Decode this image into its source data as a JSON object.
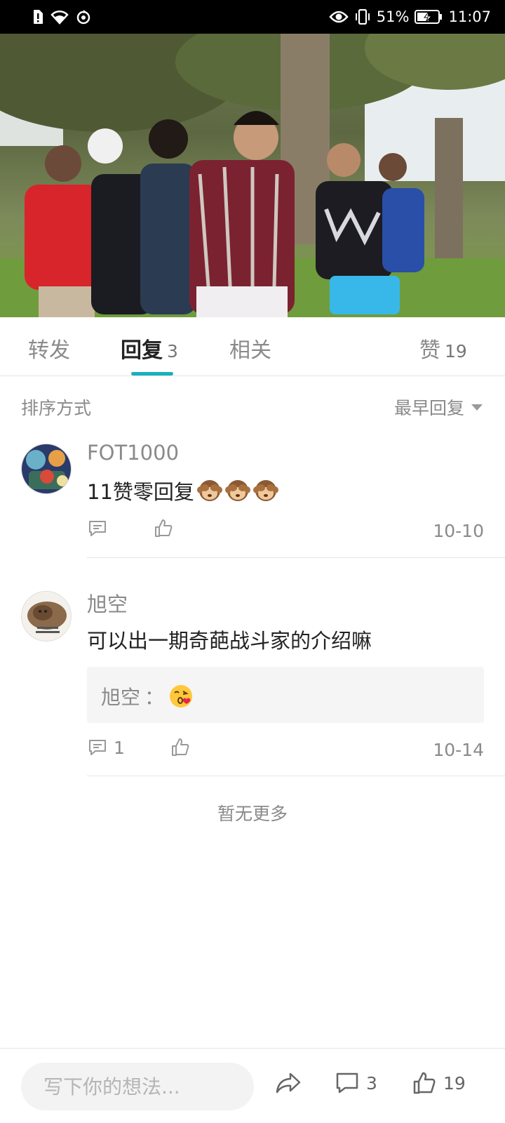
{
  "status_bar": {
    "battery": "51%",
    "time": "11:07"
  },
  "video": {
    "description_icon": "video-thumbnail"
  },
  "tabs": {
    "forward": "转发",
    "replies": "回复",
    "replies_count": "3",
    "related": "相关",
    "likes": "赞",
    "likes_count": "19"
  },
  "sort": {
    "label": "排序方式",
    "selected": "最早回复"
  },
  "comments": [
    {
      "user": "FOT1000",
      "text": "11赞零回复",
      "emojis": [
        "see-no-evil-monkey",
        "see-no-evil-monkey",
        "see-no-evil-monkey"
      ],
      "reply_count": "",
      "date": "10-10"
    },
    {
      "user": "旭空",
      "text": "可以出一期奇葩战斗家的介绍嘛",
      "reply": {
        "user": "旭空",
        "separator": "：",
        "emoji": "face-blowing-kiss"
      },
      "reply_count": "1",
      "date": "10-14"
    }
  ],
  "no_more": "暂无更多",
  "bottom_bar": {
    "placeholder": "写下你的想法...",
    "comment_count": "3",
    "like_count": "19"
  },
  "colors": {
    "accent": "#18b0be",
    "muted": "#8a8a8a"
  }
}
